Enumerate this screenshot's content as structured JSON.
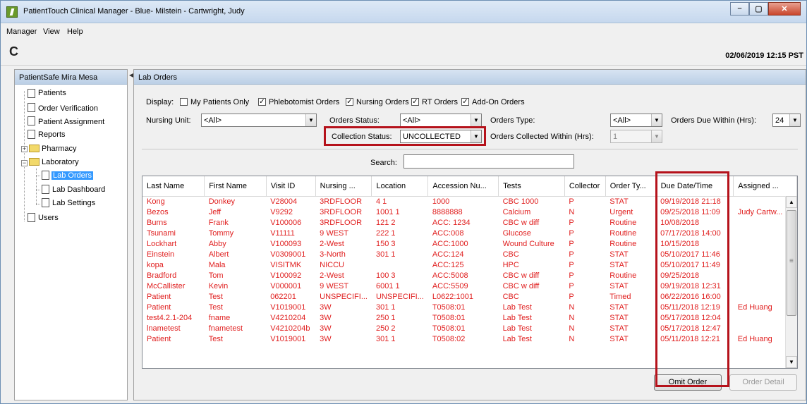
{
  "window": {
    "title": "PatientTouch Clinical Manager - Blue- Milstein - Cartwright, Judy",
    "min_glyph": "–",
    "max_glyph": "▢",
    "close_glyph": "✕"
  },
  "menu": [
    "Manager",
    "View",
    "Help"
  ],
  "toolbar": {
    "refresh_glyph": "C",
    "datetime": "02/06/2019 12:15 PST"
  },
  "sidebar": {
    "header": "PatientSafe Mira Mesa",
    "items": [
      {
        "label": "Patients"
      },
      {
        "label": "Order Verification"
      },
      {
        "label": "Patient Assignment"
      },
      {
        "label": "Reports"
      },
      {
        "label": "Pharmacy"
      },
      {
        "label": "Laboratory"
      },
      {
        "label": "Lab Orders"
      },
      {
        "label": "Lab Dashboard"
      },
      {
        "label": "Lab Settings"
      },
      {
        "label": "Users"
      }
    ]
  },
  "main": {
    "header": "Lab Orders",
    "display_label": "Display:",
    "checkboxes": [
      {
        "label": "My Patients Only",
        "checked": false
      },
      {
        "label": "Phlebotomist Orders",
        "checked": true
      },
      {
        "label": "Nursing Orders",
        "checked": true
      },
      {
        "label": "RT Orders",
        "checked": true
      },
      {
        "label": "Add-On Orders",
        "checked": true
      }
    ],
    "nursing_unit_label": "Nursing Unit:",
    "nursing_unit_value": "<All>",
    "orders_status_label": "Orders Status:",
    "orders_status_value": "<All>",
    "orders_type_label": "Orders Type:",
    "orders_type_value": "<All>",
    "orders_due_label": "Orders Due Within (Hrs):",
    "orders_due_value": "24",
    "collection_status_label": "Collection Status:",
    "collection_status_value": "UNCOLLECTED",
    "orders_collected_label": "Orders Collected Within (Hrs):",
    "orders_collected_value": "1",
    "search_label": "Search:",
    "search_value": "",
    "checkmark": "✓",
    "dropdown_glyph": "▼",
    "columns": [
      "Last Name",
      "First Name",
      "Visit ID",
      "Nursing ...",
      "Location",
      "Accession Nu...",
      "Tests",
      "Collector",
      "Order Ty...",
      "Due Date/Time",
      "Assigned ..."
    ],
    "rows": [
      [
        "Kong",
        "Donkey",
        "V28004",
        "3RDFLOOR",
        "4 1",
        "1000",
        "CBC 1000",
        "P",
        "STAT",
        "09/19/2018 21:18",
        ""
      ],
      [
        "Bezos",
        "Jeff",
        "V9292",
        "3RDFLOOR",
        "1001 1",
        "8888888",
        "Calcium",
        "N",
        "Urgent",
        "09/25/2018 11:09",
        "Judy Cartw..."
      ],
      [
        "Burns",
        "Frank",
        "V100006",
        "3RDFLOOR",
        "121 2",
        "ACC: 1234",
        "CBC w diff",
        "P",
        "Routine",
        "10/08/2018",
        ""
      ],
      [
        "Tsunami",
        "Tommy",
        "V11111",
        "9 WEST",
        "222 1",
        "ACC:008",
        "Glucose",
        "P",
        "Routine",
        "07/17/2018 14:00",
        ""
      ],
      [
        "Lockhart",
        "Abby",
        "V100093",
        "2-West",
        "150 3",
        "ACC:1000",
        "Wound Culture",
        "P",
        "Routine",
        "10/15/2018",
        ""
      ],
      [
        "Einstein",
        "Albert",
        "V0309001",
        "3-North",
        "301 1",
        "ACC:124",
        "CBC",
        "P",
        "STAT",
        "05/10/2017 11:46",
        ""
      ],
      [
        "kopa",
        "Mala",
        "VISITMK",
        "NICCU",
        "",
        "ACC:125",
        "HPC",
        "P",
        "STAT",
        "05/10/2017 11:49",
        ""
      ],
      [
        "Bradford",
        "Tom",
        "V100092",
        "2-West",
        "100 3",
        "ACC:5008",
        "CBC w diff",
        "P",
        "Routine",
        "09/25/2018",
        ""
      ],
      [
        "McCallister",
        "Kevin",
        "V000001",
        "9 WEST",
        "6001 1",
        "ACC:5509",
        "CBC w diff",
        "P",
        "STAT",
        "09/19/2018 12:31",
        ""
      ],
      [
        "Patient",
        "Test",
        "062201",
        "UNSPECIFI...",
        "UNSPECIFI...",
        "L0622:1001",
        "CBC",
        "P",
        "Timed",
        "06/22/2016 16:00",
        ""
      ],
      [
        "Patient",
        "Test",
        "V1019001",
        "3W",
        "301 1",
        "T0508:01",
        "Lab Test",
        "N",
        "STAT",
        "05/11/2018 12:19",
        "Ed Huang"
      ],
      [
        "test4.2.1-204",
        "fname",
        "V4210204",
        "3W",
        "250 1",
        "T0508:01",
        "Lab Test",
        "N",
        "STAT",
        "05/17/2018 12:04",
        ""
      ],
      [
        "lnametest",
        "fnametest",
        "V4210204b",
        "3W",
        "250 2",
        "T0508:01",
        "Lab Test",
        "N",
        "STAT",
        "05/17/2018 12:47",
        ""
      ],
      [
        "Patient",
        "Test",
        "V1019001",
        "3W",
        "301 1",
        "T0508:02",
        "Lab Test",
        "N",
        "STAT",
        "05/11/2018 12:21",
        "Ed Huang"
      ]
    ],
    "omit_button": "Omit Order",
    "detail_button": "Order Detail",
    "scroll_up": "▲",
    "scroll_down": "▼",
    "grip": "≡"
  },
  "colors": {
    "row_text": "#e01e1e",
    "highlight": "#b5121b",
    "selection": "#3399ff"
  }
}
